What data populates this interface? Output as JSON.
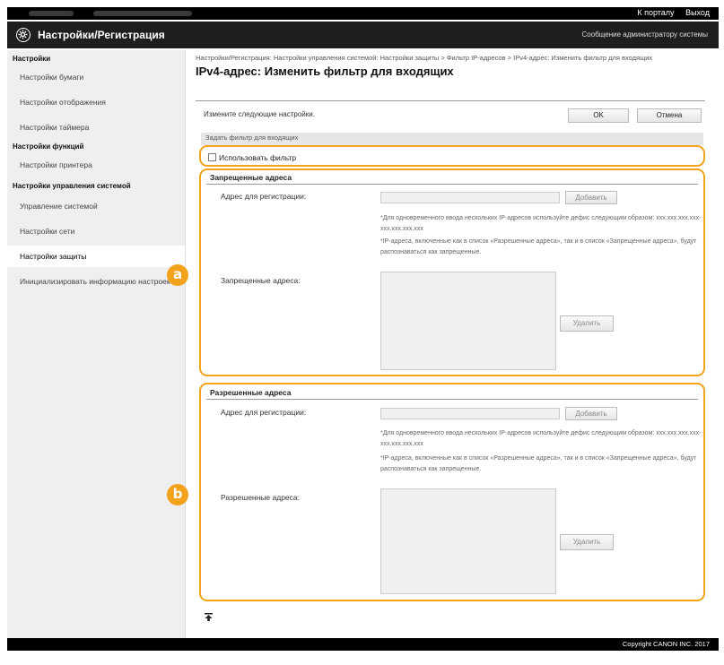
{
  "topbar": {
    "portal_link": "К порталу",
    "logout_link": "Выход"
  },
  "header": {
    "title": "Настройки/Регистрация",
    "admin_message": "Сообщение администратору системы"
  },
  "sidebar": {
    "group_settings": "Настройки",
    "item_paper": "Настройки бумаги",
    "item_display": "Настройки отображения",
    "item_timer": "Настройки таймера",
    "group_functions": "Настройки функций",
    "item_printer": "Настройки принтера",
    "group_system": "Настройки управления системой",
    "item_system_mgmt": "Управление системой",
    "item_network": "Настройки сети",
    "item_security": "Настройки защиты",
    "item_init": "Инициализировать информацию настроек"
  },
  "main": {
    "breadcrumb": "Настройки/Регистрация: Настройки управления системой: Настройки защиты > Фильтр IP-адресов > IPv4-адрес: Изменить фильтр для входящих",
    "page_title": "IPv4-адрес: Изменить фильтр для входящих",
    "instruction": "Измените следующие настройки.",
    "ok_label": "OK",
    "cancel_label": "Отмена",
    "section_bar": "Задать фильтр для входящих",
    "use_filter_label": "Использовать фильтр"
  },
  "blocked": {
    "heading": "Запрещенные адреса",
    "register_label": "Адрес для регистрации:",
    "add_label": "Добавить",
    "note1": "*Для одновременного ввода нескольких IP-адресов используйте дефис следующим образом: xxx.xxx.xxx.xxx-xxx.xxx.xxx.xxx",
    "note2": "*IP-адреса, включенные как в список «Разрешенные адреса», так и в список «Запрещенные адреса», будут распознаваться как запрещенные.",
    "list_label": "Запрещенные адреса:",
    "delete_label": "Удалить"
  },
  "allowed": {
    "heading": "Разрешенные адреса",
    "register_label": "Адрес для регистрации:",
    "add_label": "Добавить",
    "note1": "*Для одновременного ввода нескольких IP-адресов используйте дефис следующим образом: xxx.xxx.xxx.xxx-xxx.xxx.xxx.xxx",
    "note2": "*IP-адреса, включенные как в список «Разрешенные адреса», так и в список «Запрещенные адреса», будут распознаваться как запрещенные.",
    "list_label": "Разрешенные адреса:",
    "delete_label": "Удалить"
  },
  "callouts": {
    "a": "a",
    "b": "b"
  },
  "footer": {
    "copyright": "Copyright CANON INC. 2017"
  },
  "colors": {
    "callout": "#f2a21b",
    "header_bg": "#1e1e1e",
    "sidebar_bg": "#efefef"
  }
}
